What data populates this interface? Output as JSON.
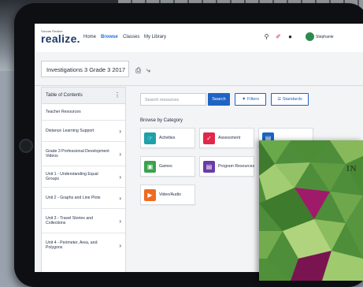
{
  "app": {
    "logo_small": "Savvas Realize",
    "logo": "realize.",
    "nav": [
      "Home",
      "Browse",
      "Classes",
      "My Library"
    ],
    "active_nav": "Browse",
    "user": "Stephanie"
  },
  "program": {
    "title": "Investigations 3 Grade 3 2017"
  },
  "toc": {
    "header": "Table of Contents",
    "items": [
      {
        "label": "Teacher Resources",
        "chevron": false
      },
      {
        "label": "Distance Learning Support",
        "chevron": true
      },
      {
        "label": "Grade 3 Professional Development Videos",
        "chevron": true
      },
      {
        "label": "Unit 1 - Understanding Equal Groups",
        "chevron": true
      },
      {
        "label": "Unit 2 - Graphs and Line Plots",
        "chevron": true
      },
      {
        "label": "Unit 3 - Travel Stories and Collections",
        "chevron": true
      },
      {
        "label": "Unit 4 - Perimeter, Area, and Polygons",
        "chevron": true
      }
    ]
  },
  "search": {
    "placeholder": "Search resources",
    "button": "Search",
    "filters": "Filters",
    "standards": "Standards"
  },
  "categories": {
    "heading": "Browse by Category",
    "items": [
      {
        "label": "Activities",
        "color": "#1fa0a8",
        "icon": "hand-pointer-icon"
      },
      {
        "label": "Assessment",
        "color": "#e0284a",
        "icon": "check-list-icon"
      },
      {
        "label": "",
        "color": "#1e63c4",
        "icon": "book-icon"
      },
      {
        "label": "Games",
        "color": "#3aa24d",
        "icon": "game-icon"
      },
      {
        "label": "Program Resources",
        "color": "#6c3aa8",
        "icon": "folder-icon"
      },
      {
        "label": "Video/Audio",
        "color": "#f06a22",
        "icon": "play-icon"
      }
    ]
  },
  "book": {
    "title": "IN"
  },
  "colors": {
    "accent": "#1e63c4",
    "brand": "#1d3a6b",
    "book_green": "#4e8e3a",
    "book_magenta": "#a01a6a"
  }
}
